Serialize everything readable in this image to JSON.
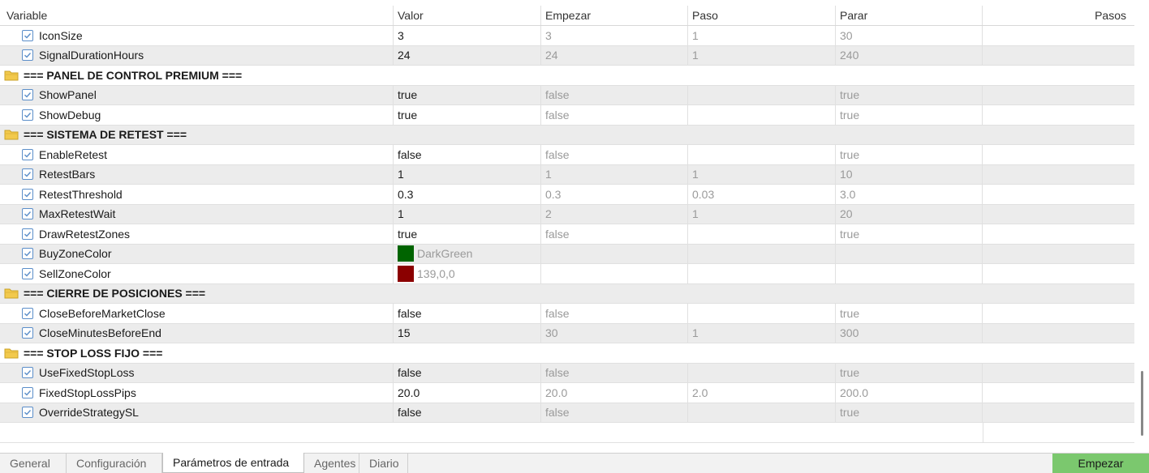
{
  "columns": {
    "variable": "Variable",
    "value": "Valor",
    "start": "Empezar",
    "step": "Paso",
    "stop": "Parar",
    "steps": "Pasos"
  },
  "rows": [
    {
      "type": "param",
      "name": "IconSize",
      "value": "3",
      "start": "3",
      "step": "1",
      "stop": "30"
    },
    {
      "type": "param",
      "name": "SignalDurationHours",
      "value": "24",
      "start": "24",
      "step": "1",
      "stop": "240"
    },
    {
      "type": "group",
      "name": "=== PANEL DE CONTROL PREMIUM ==="
    },
    {
      "type": "param",
      "name": "ShowPanel",
      "value": "true",
      "start": "false",
      "step": "",
      "stop": "true"
    },
    {
      "type": "param",
      "name": "ShowDebug",
      "value": "true",
      "start": "false",
      "step": "",
      "stop": "true"
    },
    {
      "type": "group",
      "name": "=== SISTEMA DE RETEST ==="
    },
    {
      "type": "param",
      "name": "EnableRetest",
      "value": "false",
      "start": "false",
      "step": "",
      "stop": "true"
    },
    {
      "type": "param",
      "name": "RetestBars",
      "value": "1",
      "start": "1",
      "step": "1",
      "stop": "10"
    },
    {
      "type": "param",
      "name": "RetestThreshold",
      "value": "0.3",
      "start": "0.3",
      "step": "0.03",
      "stop": "3.0"
    },
    {
      "type": "param",
      "name": "MaxRetestWait",
      "value": "1",
      "start": "2",
      "step": "1",
      "stop": "20"
    },
    {
      "type": "param",
      "name": "DrawRetestZones",
      "value": "true",
      "start": "false",
      "step": "",
      "stop": "true"
    },
    {
      "type": "color",
      "name": "BuyZoneColor",
      "value": "DarkGreen",
      "swatch": "#006400"
    },
    {
      "type": "color",
      "name": "SellZoneColor",
      "value": "139,0,0",
      "swatch": "#8b0000"
    },
    {
      "type": "group",
      "name": "=== CIERRE DE POSICIONES ==="
    },
    {
      "type": "param",
      "name": "CloseBeforeMarketClose",
      "value": "false",
      "start": "false",
      "step": "",
      "stop": "true"
    },
    {
      "type": "param",
      "name": "CloseMinutesBeforeEnd",
      "value": "15",
      "start": "30",
      "step": "1",
      "stop": "300"
    },
    {
      "type": "group",
      "name": "=== STOP LOSS FIJO ==="
    },
    {
      "type": "param",
      "name": "UseFixedStopLoss",
      "value": "false",
      "start": "false",
      "step": "",
      "stop": "true"
    },
    {
      "type": "param",
      "name": "FixedStopLossPips",
      "value": "20.0",
      "start": "20.0",
      "step": "2.0",
      "stop": "200.0"
    },
    {
      "type": "param",
      "name": "OverrideStrategySL",
      "value": "false",
      "start": "false",
      "step": "",
      "stop": "true"
    }
  ],
  "tabs": [
    {
      "label": "General",
      "active": false
    },
    {
      "label": "Configuración",
      "active": false
    },
    {
      "label": "Parámetros de entrada",
      "active": true
    },
    {
      "label": "Agentes",
      "active": false
    },
    {
      "label": "Diario",
      "active": false
    }
  ],
  "start_button": "Empezar",
  "colors": {
    "accent_check": "#5b8ec9",
    "folder": "#f2c94c",
    "start_button": "#7bc86e"
  }
}
